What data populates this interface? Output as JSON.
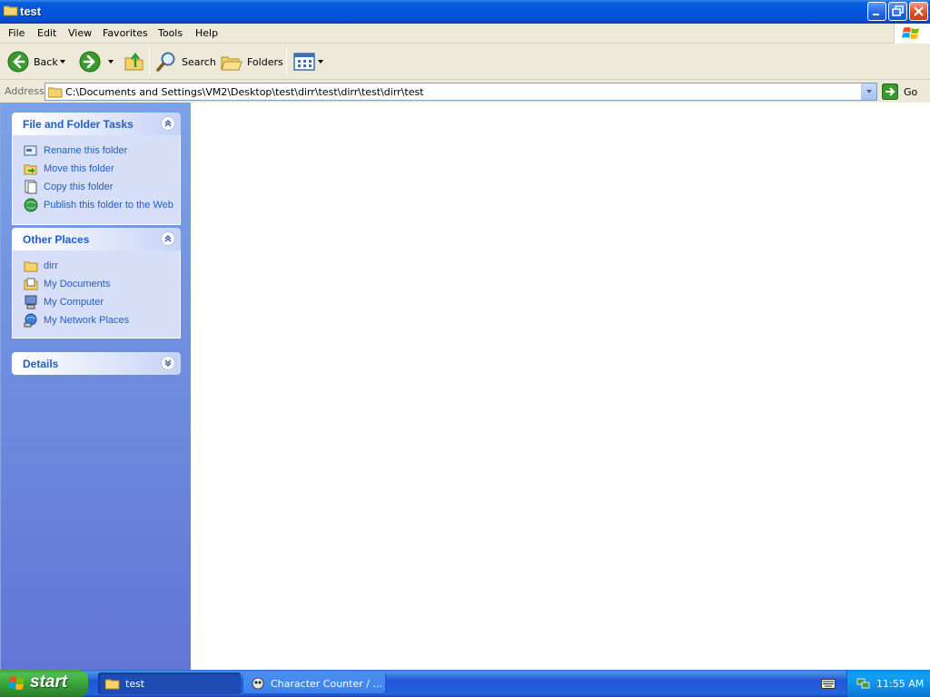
{
  "window": {
    "title": "test"
  },
  "menu": {
    "items": [
      "File",
      "Edit",
      "View",
      "Favorites",
      "Tools",
      "Help"
    ]
  },
  "toolbar": {
    "back_label": "Back",
    "search_label": "Search",
    "folders_label": "Folders",
    "icons": [
      "back-arrow-icon",
      "forward-arrow-icon",
      "up-folder-icon",
      "search-magnifier-icon",
      "folders-icon",
      "views-icon"
    ]
  },
  "address": {
    "label": "Address",
    "value": "C:\\Documents and Settings\\VM2\\Desktop\\test\\dirr\\test\\dirr\\test\\dirr\\test",
    "go_label": "Go"
  },
  "tasks_panel": {
    "title": "File and Folder Tasks",
    "links": [
      {
        "label": "Rename this folder",
        "icon": "rename-icon"
      },
      {
        "label": "Move this folder",
        "icon": "move-icon"
      },
      {
        "label": "Copy this folder",
        "icon": "copy-icon"
      },
      {
        "label": "Publish this folder to the Web",
        "icon": "globe-publish-icon"
      }
    ]
  },
  "places_panel": {
    "title": "Other Places",
    "links": [
      {
        "label": "dirr",
        "icon": "folder-icon"
      },
      {
        "label": "My Documents",
        "icon": "my-documents-icon"
      },
      {
        "label": "My Computer",
        "icon": "my-computer-icon"
      },
      {
        "label": "My Network Places",
        "icon": "network-places-icon"
      }
    ]
  },
  "details_panel": {
    "title": "Details"
  },
  "taskbar": {
    "start_label": "start",
    "tasks": [
      {
        "label": "test",
        "icon": "folder-icon",
        "active": true
      },
      {
        "label": "Character Counter / ...",
        "icon": "app-icon",
        "active": false
      }
    ],
    "clock": "11:55 AM"
  },
  "colors": {
    "title_bar": "#0454dd",
    "link_blue": "#215dc6",
    "taskbar_blue": "#2157d7",
    "start_green": "#379b37"
  }
}
